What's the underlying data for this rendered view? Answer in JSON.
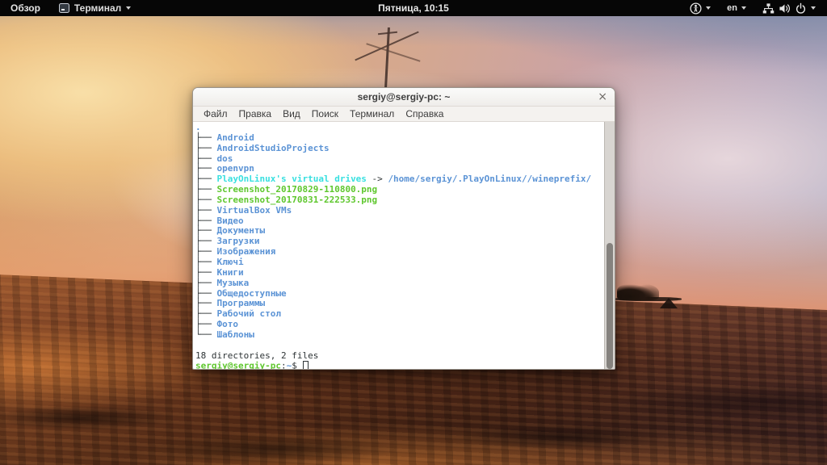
{
  "top_bar": {
    "activities": "Обзор",
    "app_menu_label": "Терминал",
    "clock": "Пятница, 10:15",
    "keyboard_layout": "en",
    "icons": [
      "accessibility-icon",
      "keyboard-caret",
      "network-wired-icon",
      "volume-icon",
      "power-icon"
    ]
  },
  "window": {
    "title": "sergiy@sergiy-pc: ~",
    "close_glyph": "×",
    "menu": [
      "Файл",
      "Правка",
      "Вид",
      "Поиск",
      "Терминал",
      "Справка"
    ],
    "terminal": {
      "root": ".",
      "listing": [
        {
          "branch": "├── ",
          "name": "Android",
          "type": "dir"
        },
        {
          "branch": "├── ",
          "name": "AndroidStudioProjects",
          "type": "dir"
        },
        {
          "branch": "├── ",
          "name": "dos",
          "type": "dir"
        },
        {
          "branch": "├── ",
          "name": "openvpn",
          "type": "dir"
        },
        {
          "branch": "├── ",
          "name": "PlayOnLinux's virtual drives",
          "type": "symlink",
          "arrow": " -> ",
          "target": "/home/sergiy/.PlayOnLinux//wineprefix/"
        },
        {
          "branch": "├── ",
          "name": "Screenshot_20170829-110800.png",
          "type": "file"
        },
        {
          "branch": "├── ",
          "name": "Screenshot_20170831-222533.png",
          "type": "file"
        },
        {
          "branch": "├── ",
          "name": "VirtualBox VMs",
          "type": "dir"
        },
        {
          "branch": "├── ",
          "name": "Видео",
          "type": "dir"
        },
        {
          "branch": "├── ",
          "name": "Документы",
          "type": "dir"
        },
        {
          "branch": "├── ",
          "name": "Загрузки",
          "type": "dir"
        },
        {
          "branch": "├── ",
          "name": "Изображения",
          "type": "dir"
        },
        {
          "branch": "├── ",
          "name": "Ключі",
          "type": "dir"
        },
        {
          "branch": "├── ",
          "name": "Книги",
          "type": "dir"
        },
        {
          "branch": "├── ",
          "name": "Музыка",
          "type": "dir"
        },
        {
          "branch": "├── ",
          "name": "Общедоступные",
          "type": "dir"
        },
        {
          "branch": "├── ",
          "name": "Программы",
          "type": "dir"
        },
        {
          "branch": "├── ",
          "name": "Рабочий стол",
          "type": "dir"
        },
        {
          "branch": "├── ",
          "name": "Фото",
          "type": "dir"
        },
        {
          "branch": "└── ",
          "name": "Шаблоны",
          "type": "dir"
        }
      ],
      "summary": "18 directories, 2 files",
      "prompt": {
        "user_host": "sergiy@sergiy-pc",
        "colon": ":",
        "path": "~",
        "dollar": "$ "
      }
    }
  },
  "colors": {
    "fg": "#2e3436",
    "dir": "#5b93d5",
    "symlink": "#38e0e0",
    "file": "#5fc72e",
    "prompt": "#5fc72e"
  }
}
